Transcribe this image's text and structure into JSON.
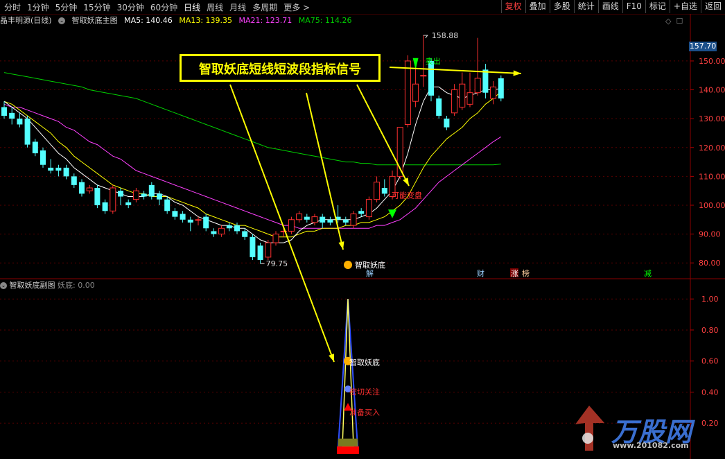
{
  "toolbar": {
    "periods": [
      "分时",
      "1分钟",
      "5分钟",
      "15分钟",
      "30分钟",
      "60分钟",
      "日线",
      "周线",
      "月线",
      "多周期",
      "更多 >"
    ],
    "active_period": "日线",
    "right_buttons": [
      "复权",
      "叠加",
      "多股",
      "统计",
      "画线",
      "F10",
      "标记",
      "+自选",
      "返回"
    ]
  },
  "info": {
    "stock": "晶丰明源(日线)",
    "indicator": "智取妖底主图",
    "ma5": "MA5: 140.46",
    "ma13": "MA13: 139.35",
    "ma21": "MA21: 123.71",
    "ma75": "MA75: 114.26"
  },
  "sub": {
    "name": "智取妖底副图",
    "value": "妖底: 0.00"
  },
  "price_tag": "157.70",
  "callout": "智取妖底短线短波段指标信号",
  "annotations": {
    "high": "158.88",
    "low": "79.75",
    "sell": "卖出",
    "maybe": "可能变盘",
    "yaodi_main": "智取妖底",
    "yaodi_sub": "智取妖底",
    "focus": "密切关注",
    "buy": "准备买入",
    "jie": "解",
    "cai": "财",
    "zhang": "涨",
    "bang": "榜",
    "jian": "减"
  },
  "price_axis": [
    "150.00",
    "140.00",
    "130.00",
    "120.00",
    "110.00",
    "100.00",
    "90.00",
    "80.00"
  ],
  "sub_axis": [
    "1.00",
    "0.80",
    "0.60",
    "0.40",
    "0.20"
  ],
  "watermark": {
    "brand": "万股网",
    "url": "www.201082.com"
  },
  "colors": {
    "up": "#ff3030",
    "down": "#54ffff",
    "ma5": "#ffffff",
    "ma13": "#ffff00",
    "ma21": "#ff40ff",
    "ma75": "#00d000",
    "grid": "#5a0000"
  },
  "chart_data": {
    "type": "candlestick",
    "ylim": [
      75,
      162
    ],
    "candles": [
      {
        "o": 134,
        "c": 131,
        "h": 136,
        "l": 130
      },
      {
        "o": 132,
        "c": 130,
        "h": 134,
        "l": 128
      },
      {
        "o": 130,
        "c": 128,
        "h": 132,
        "l": 127
      },
      {
        "o": 130,
        "c": 121,
        "h": 131,
        "l": 120
      },
      {
        "o": 122,
        "c": 118,
        "h": 123,
        "l": 117
      },
      {
        "o": 119,
        "c": 114,
        "h": 120,
        "l": 113
      },
      {
        "o": 113,
        "c": 112,
        "h": 116,
        "l": 111
      },
      {
        "o": 113,
        "c": 112,
        "h": 114,
        "l": 110
      },
      {
        "o": 113,
        "c": 110,
        "h": 114,
        "l": 109
      },
      {
        "o": 110,
        "c": 107,
        "h": 111,
        "l": 106
      },
      {
        "o": 108,
        "c": 104,
        "h": 109,
        "l": 103
      },
      {
        "o": 105,
        "c": 106,
        "h": 107,
        "l": 104
      },
      {
        "o": 106,
        "c": 100,
        "h": 107,
        "l": 99
      },
      {
        "o": 101,
        "c": 98,
        "h": 102,
        "l": 97
      },
      {
        "o": 98,
        "c": 106,
        "h": 107,
        "l": 97
      },
      {
        "o": 105,
        "c": 103,
        "h": 106,
        "l": 100
      },
      {
        "o": 101,
        "c": 100,
        "h": 102,
        "l": 99
      },
      {
        "o": 102,
        "c": 105,
        "h": 106,
        "l": 101
      },
      {
        "o": 104,
        "c": 103,
        "h": 105,
        "l": 102
      },
      {
        "o": 107,
        "c": 103,
        "h": 108,
        "l": 102
      },
      {
        "o": 104,
        "c": 102,
        "h": 105,
        "l": 100
      },
      {
        "o": 102,
        "c": 98,
        "h": 103,
        "l": 97
      },
      {
        "o": 98,
        "c": 96,
        "h": 99,
        "l": 95
      },
      {
        "o": 97,
        "c": 95,
        "h": 98,
        "l": 94
      },
      {
        "o": 95,
        "c": 94,
        "h": 96,
        "l": 91
      },
      {
        "o": 95,
        "c": 95,
        "h": 96,
        "l": 93
      },
      {
        "o": 96,
        "c": 92,
        "h": 97,
        "l": 91
      },
      {
        "o": 91,
        "c": 90,
        "h": 92,
        "l": 89
      },
      {
        "o": 90,
        "c": 92,
        "h": 93,
        "l": 89
      },
      {
        "o": 93,
        "c": 92,
        "h": 94,
        "l": 91
      },
      {
        "o": 93,
        "c": 91,
        "h": 94,
        "l": 90
      },
      {
        "o": 91,
        "c": 89,
        "h": 92,
        "l": 88
      },
      {
        "o": 89,
        "c": 82,
        "h": 90,
        "l": 81
      },
      {
        "o": 86,
        "c": 81,
        "h": 87,
        "l": 79.75
      },
      {
        "o": 82,
        "c": 87,
        "h": 88,
        "l": 81
      },
      {
        "o": 87,
        "c": 90,
        "h": 91,
        "l": 86
      },
      {
        "o": 91,
        "c": 91,
        "h": 93,
        "l": 89
      },
      {
        "o": 91,
        "c": 95,
        "h": 96,
        "l": 90
      },
      {
        "o": 95,
        "c": 97,
        "h": 98,
        "l": 94
      },
      {
        "o": 96,
        "c": 95,
        "h": 97,
        "l": 94
      },
      {
        "o": 94,
        "c": 96,
        "h": 97,
        "l": 93
      },
      {
        "o": 96,
        "c": 94,
        "h": 97,
        "l": 92
      },
      {
        "o": 95,
        "c": 94,
        "h": 96,
        "l": 93
      },
      {
        "o": 96,
        "c": 95,
        "h": 100,
        "l": 94
      },
      {
        "o": 95,
        "c": 94,
        "h": 96,
        "l": 93
      },
      {
        "o": 93,
        "c": 97,
        "h": 98,
        "l": 92
      },
      {
        "o": 98,
        "c": 97,
        "h": 99,
        "l": 96
      },
      {
        "o": 96,
        "c": 102,
        "h": 103,
        "l": 95
      },
      {
        "o": 102,
        "c": 108,
        "h": 110,
        "l": 101
      },
      {
        "o": 106,
        "c": 104,
        "h": 109,
        "l": 103
      },
      {
        "o": 103,
        "c": 110,
        "h": 112,
        "l": 102
      },
      {
        "o": 110,
        "c": 127,
        "h": 127,
        "l": 109
      },
      {
        "o": 128,
        "c": 150,
        "h": 152,
        "l": 127
      },
      {
        "o": 136,
        "c": 142,
        "h": 150,
        "l": 134
      },
      {
        "o": 145,
        "c": 145,
        "h": 158.88,
        "l": 141
      },
      {
        "o": 150,
        "c": 138,
        "h": 151,
        "l": 136
      },
      {
        "o": 137,
        "c": 131,
        "h": 138,
        "l": 130
      },
      {
        "o": 130,
        "c": 127,
        "h": 131,
        "l": 126
      },
      {
        "o": 132,
        "c": 140,
        "h": 142,
        "l": 131
      },
      {
        "o": 134,
        "c": 142,
        "h": 146,
        "l": 133
      },
      {
        "o": 135,
        "c": 139,
        "h": 146,
        "l": 134
      },
      {
        "o": 139,
        "c": 144,
        "h": 158,
        "l": 138
      },
      {
        "o": 147,
        "c": 139,
        "h": 149,
        "l": 137
      },
      {
        "o": 137,
        "c": 141,
        "h": 143,
        "l": 135
      },
      {
        "o": 144,
        "c": 137,
        "h": 145,
        "l": 136
      }
    ],
    "ma5": [
      136,
      134,
      132,
      130,
      127,
      124,
      121,
      118,
      116,
      113,
      111,
      109,
      107,
      106,
      105,
      104,
      103,
      103,
      103,
      104,
      104,
      103,
      101,
      100,
      98,
      96,
      95,
      94,
      93,
      93,
      92,
      92,
      90,
      88,
      87,
      87,
      87,
      88,
      91,
      93,
      94,
      95,
      95,
      95,
      95,
      95,
      96,
      97,
      99,
      102,
      105,
      110,
      118,
      128,
      136,
      141,
      141,
      139,
      138,
      137,
      138,
      139,
      140,
      140,
      140.46
    ],
    "ma13": [
      136,
      135,
      133,
      131,
      129,
      127,
      125,
      122,
      120,
      117,
      115,
      113,
      111,
      109,
      107,
      106,
      105,
      104,
      104,
      103,
      103,
      103,
      102,
      101,
      100,
      99,
      97,
      96,
      95,
      94,
      93,
      93,
      92,
      91,
      90,
      89,
      89,
      89,
      90,
      91,
      91,
      92,
      92,
      92,
      93,
      93,
      94,
      94,
      95,
      96,
      98,
      100,
      103,
      108,
      113,
      117,
      120,
      123,
      125,
      127,
      130,
      132,
      135,
      137,
      139.35
    ],
    "ma21": [
      135,
      134,
      134,
      133,
      132,
      131,
      130,
      129,
      127,
      126,
      124,
      122,
      121,
      119,
      117,
      116,
      114,
      112,
      111,
      110,
      109,
      108,
      107,
      106,
      105,
      104,
      103,
      102,
      101,
      100,
      99,
      98,
      97,
      96,
      95,
      94,
      93,
      93,
      92,
      92,
      92,
      92,
      92,
      92,
      92,
      92,
      92,
      92,
      93,
      93,
      94,
      95,
      97,
      99,
      102,
      105,
      108,
      110,
      112,
      114,
      116,
      118,
      120,
      122,
      123.71
    ],
    "ma75": [
      146,
      145.5,
      145,
      144.5,
      144,
      143.5,
      143,
      142.5,
      142,
      141.5,
      141,
      140,
      139.5,
      139,
      138.5,
      138,
      137.5,
      137,
      136,
      135,
      134,
      133,
      132,
      131,
      130,
      129,
      128,
      127,
      126,
      125,
      124,
      123,
      122,
      121,
      120,
      119.5,
      119,
      118.5,
      118,
      117.5,
      117,
      116.5,
      116,
      115.5,
      115,
      115,
      114.5,
      114.5,
      114,
      114,
      114,
      114,
      114,
      114,
      114,
      114,
      114,
      114,
      114,
      114,
      114,
      114,
      114,
      114,
      114.26
    ],
    "sub_ylim": [
      0,
      1.05
    ]
  }
}
